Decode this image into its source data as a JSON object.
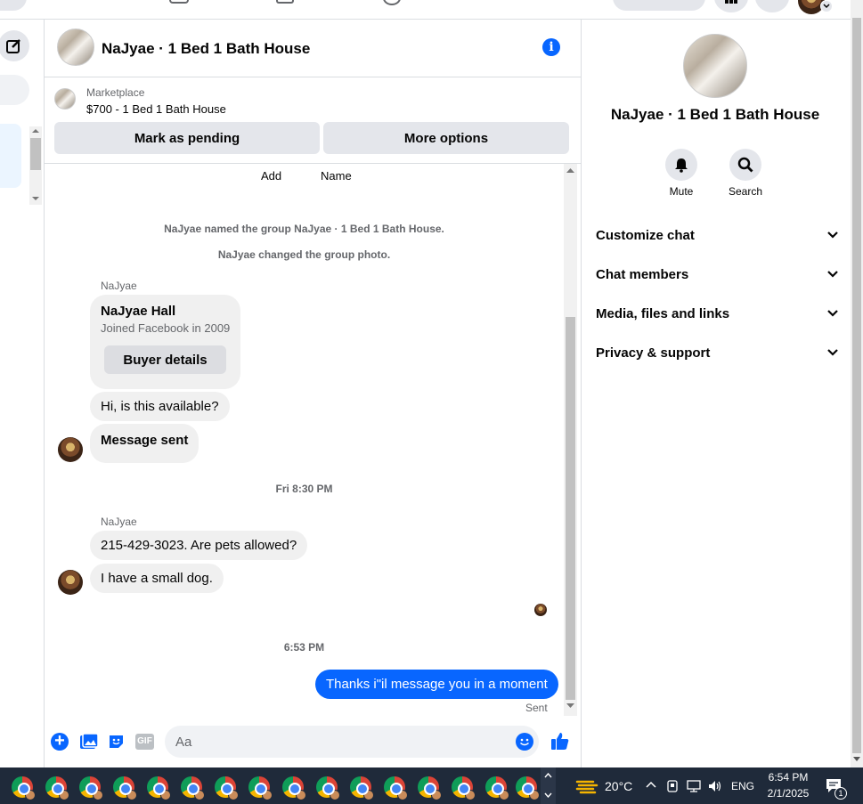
{
  "header": {
    "title": "NaJyae · 1 Bed 1 Bath House"
  },
  "marketplace": {
    "label": "Marketplace",
    "listing": "$700 - 1 Bed 1 Bath House",
    "mark_pending": "Mark as pending",
    "more_options": "More options"
  },
  "chat": {
    "top_actions": [
      "Add",
      "Name"
    ],
    "system_named": "NaJyae named the group NaJyae · 1 Bed 1 Bath House.",
    "system_photo": "NaJyae changed the group photo.",
    "sender_1": "NaJyae",
    "profile_name": "NaJyae Hall",
    "profile_joined": "Joined Facebook in 2009",
    "buyer_details": "Buyer details",
    "msg_available": "Hi, is this available?",
    "msg_sent_label": "Message sent",
    "time_1": "Fri 8:30 PM",
    "sender_2": "NaJyae",
    "msg_phone": "215-429-3023. Are pets allowed?",
    "msg_dog": "I have a small dog.",
    "time_2": "6:53 PM",
    "msg_out": "Thanks i\"il message you in a moment",
    "status": "Sent"
  },
  "composer": {
    "placeholder": "Aa"
  },
  "right_panel": {
    "title": "NaJyae · 1 Bed 1 Bath House",
    "mute": "Mute",
    "search": "Search",
    "sections": [
      "Customize chat",
      "Chat members",
      "Media, files and links",
      "Privacy & support"
    ]
  },
  "taskbar": {
    "weather": "20°C",
    "lang": "ENG",
    "time": "6:54 PM",
    "date": "2/1/2025",
    "notif_count": "1"
  },
  "colors": {
    "accent": "#0866ff",
    "bubble_grey": "#f0f0f0",
    "taskbar": "#1f2a3a"
  }
}
